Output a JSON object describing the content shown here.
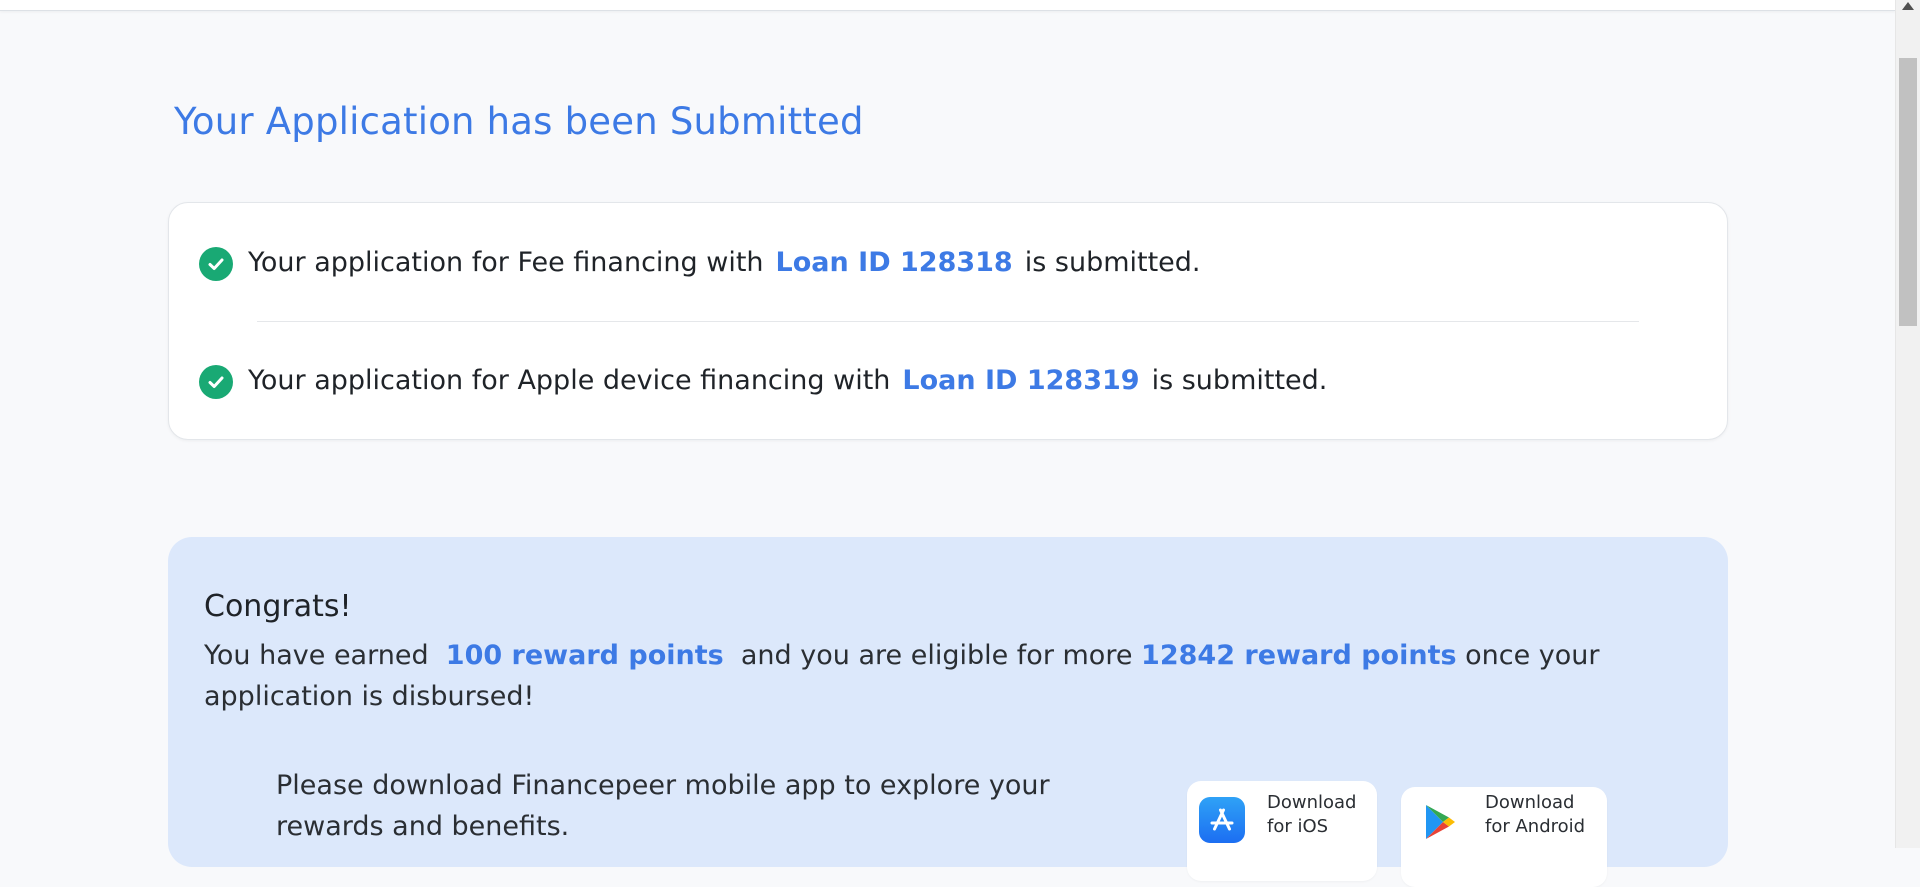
{
  "page": {
    "title": "Your Application has been Submitted"
  },
  "applications": [
    {
      "prefix": "Your application for Fee financing with",
      "loan_id": "Loan ID 128318",
      "suffix": "is submitted."
    },
    {
      "prefix": "Your application for Apple device financing with",
      "loan_id": "Loan ID 128319",
      "suffix": "is submitted."
    }
  ],
  "rewards": {
    "heading": "Congrats!",
    "text_1": "You have earned",
    "earned_points": "100 reward points",
    "text_2": "and you are eligible for more",
    "eligible_points": "12842 reward points",
    "text_3": "once your application is disbursed!",
    "download_prompt": "Please download Financepeer mobile app to explore your rewards and benefits.",
    "ios_button": {
      "line1": "Download",
      "line2": "for iOS",
      "icon": "app-store-icon"
    },
    "android_button": {
      "line1": "Download",
      "line2": "for Android",
      "icon": "google-play-icon"
    }
  },
  "colors": {
    "accent": "#3d7ae5",
    "success": "#19a974",
    "promo_background": "#dce8fb"
  }
}
